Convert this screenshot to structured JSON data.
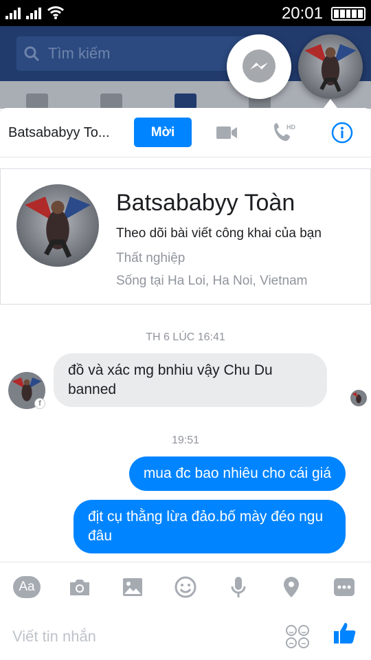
{
  "status_bar": {
    "time": "20:01"
  },
  "background_app": {
    "search_placeholder": "Tìm kiếm"
  },
  "conversation": {
    "contact_name": "Batsababyy To...",
    "invite_label": "Mời"
  },
  "profile": {
    "name": "Batsababyy Toàn",
    "follow_text": "Theo dõi bài viết công khai của bạn",
    "job": "Thất nghiệp",
    "location": "Sống tại Ha Loi, Ha Noi, Vietnam"
  },
  "messages": [
    {
      "timestamp": "TH 6 LÚC 16:41"
    },
    {
      "sender": "contact",
      "text": "đồ và xác mg bnhiu vậy Chu Du banned"
    },
    {
      "timestamp": "19:51"
    },
    {
      "sender": "me",
      "text": "mua đc bao nhiêu cho cái giá"
    },
    {
      "sender": "me",
      "text": "địt cụ thằng lừa đảo.bố mày đéo ngu đâu"
    }
  ],
  "composer": {
    "aa_label": "Aa",
    "placeholder": "Viết tin nhắn",
    "tools": [
      "aa-icon",
      "camera-icon",
      "gallery-icon",
      "emoji-icon",
      "microphone-icon",
      "location-icon",
      "more-icon"
    ]
  },
  "colors": {
    "accent": "#0084ff",
    "fb_header": "#213b6d",
    "bubble_in": "#eaebed"
  }
}
